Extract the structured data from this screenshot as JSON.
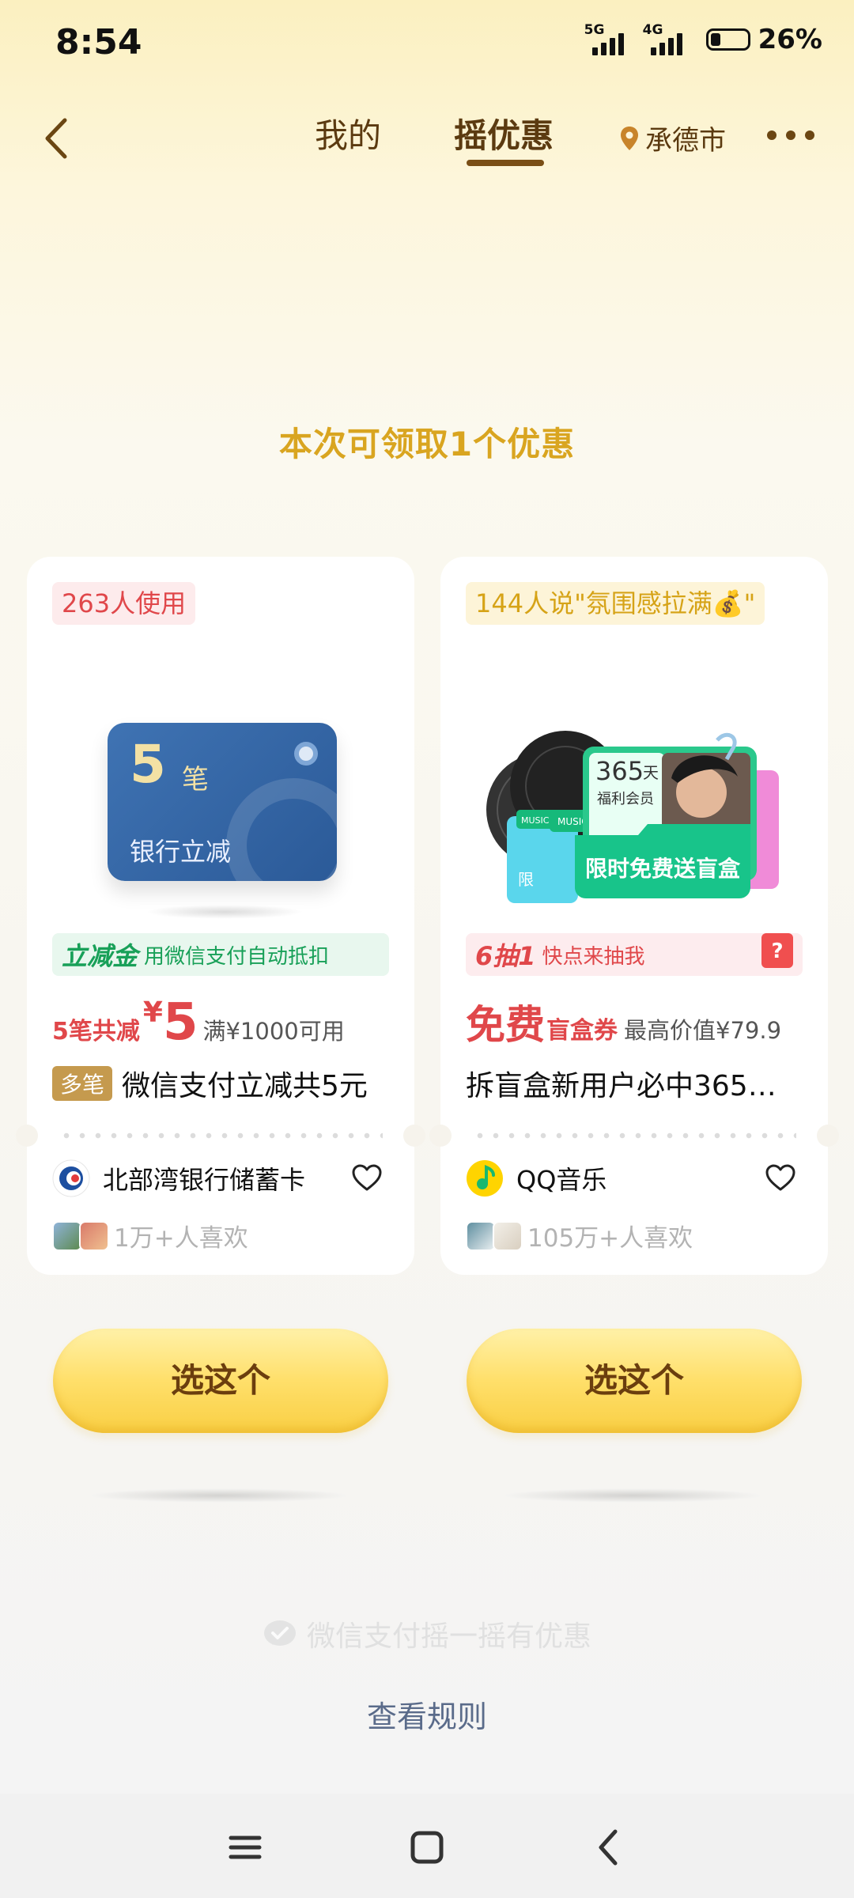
{
  "status_bar": {
    "time": "8:54",
    "signal1_label": "5G",
    "signal2_label": "4G",
    "battery": "26%",
    "battery_level": 0.26
  },
  "header": {
    "tabs": [
      {
        "label": "我的",
        "active": false
      },
      {
        "label": "摇优惠",
        "active": true
      }
    ],
    "location": "承德市"
  },
  "headline": "本次可领取1个优惠",
  "cards": [
    {
      "badge": "263人使用",
      "art": {
        "count": "5",
        "unit": "笔",
        "text": "银行立减"
      },
      "promo_bold": "立减金",
      "promo_text": "用微信支付自动抵扣",
      "price_prefix": "5笔共减",
      "currency": "¥",
      "amount": "5",
      "condition": "满¥1000可用",
      "tag": "多笔",
      "title": "微信支付立减共5元",
      "brand": "北部湾银行储蓄卡",
      "likes": "1万+人喜欢",
      "button": "选这个"
    },
    {
      "badge": "144人说\"氛围感拉满💰\"",
      "art": {
        "days": "365",
        "days_unit": "天",
        "member": "福利会员",
        "music_tag": "MUSIC",
        "limited_short": "限",
        "banner": "限时免费送盲盒"
      },
      "promo_bold": "6抽1",
      "promo_text": "快点来抽我",
      "price_prefix": "免费",
      "price_suffix": "盲盒券",
      "condition": "最高价值¥79.9",
      "title": "拆盲盒新用户必中365…",
      "brand": "QQ音乐",
      "likes": "105万+人喜欢",
      "button": "选这个"
    }
  ],
  "footer": {
    "brand": "微信支付摇一摇有优惠",
    "rules": "查看规则"
  }
}
